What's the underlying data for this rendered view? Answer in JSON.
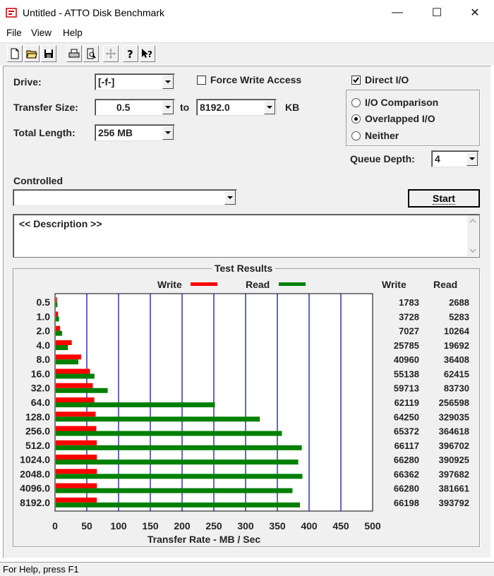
{
  "window": {
    "title": "Untitled - ATTO Disk Benchmark",
    "minimize_glyph": "—",
    "maximize_glyph": "☐",
    "close_glyph": "✕"
  },
  "menu": [
    "File",
    "View",
    "Help"
  ],
  "toolbar": {
    "icons": [
      "new-file-icon",
      "open-folder-icon",
      "save-icon",
      "print-icon",
      "print-preview-icon",
      "move-icon",
      "help-icon",
      "context-help-icon"
    ]
  },
  "form": {
    "drive_label": "Drive:",
    "drive_value": "[-f-]",
    "transfer_size_label": "Transfer Size:",
    "transfer_from": "0.5",
    "to_label": "to",
    "transfer_to": "8192.0",
    "kb_label": "KB",
    "total_length_label": "Total Length:",
    "total_length_value": "256 MB",
    "force_write_label": "Force Write Access",
    "force_write_checked": false,
    "direct_io_label": "Direct I/O",
    "direct_io_checked": true,
    "io_options": [
      {
        "label": "I/O Comparison",
        "selected": false
      },
      {
        "label": "Overlapped I/O",
        "selected": true
      },
      {
        "label": "Neither",
        "selected": false
      }
    ],
    "queue_depth_label": "Queue Depth:",
    "queue_depth_value": "4",
    "controlled_label": "Controlled",
    "controlled_value": "",
    "start_label": "Start",
    "description": "<< Description >>"
  },
  "results": {
    "title": "Test Results",
    "write_col": "Write",
    "read_col": "Read"
  },
  "chart_data": {
    "type": "bar",
    "orientation": "horizontal",
    "xlabel": "Transfer Rate - MB / Sec",
    "xlim": [
      0,
      500
    ],
    "xticks": [
      "0",
      "50",
      "100",
      "150",
      "200",
      "250",
      "300",
      "350",
      "400",
      "450",
      "500"
    ],
    "categories": [
      "0.5",
      "1.0",
      "2.0",
      "4.0",
      "8.0",
      "16.0",
      "32.0",
      "64.0",
      "128.0",
      "256.0",
      "512.0",
      "1024.0",
      "2048.0",
      "4096.0",
      "8192.0"
    ],
    "series": [
      {
        "name": "Write",
        "color": "#ff0000",
        "values_kb": [
          1783,
          3728,
          7027,
          25785,
          40960,
          55138,
          59713,
          62119,
          64250,
          65372,
          66117,
          66280,
          66362,
          66280,
          66198
        ]
      },
      {
        "name": "Read",
        "color": "#008000",
        "values_kb": [
          2688,
          5283,
          10264,
          19692,
          36408,
          62415,
          83730,
          256598,
          329035,
          364618,
          396702,
          390925,
          397682,
          381661,
          393792
        ]
      }
    ],
    "legend": "top",
    "grid": true,
    "grid_color": "#0000a0"
  },
  "status": "For Help, press F1"
}
